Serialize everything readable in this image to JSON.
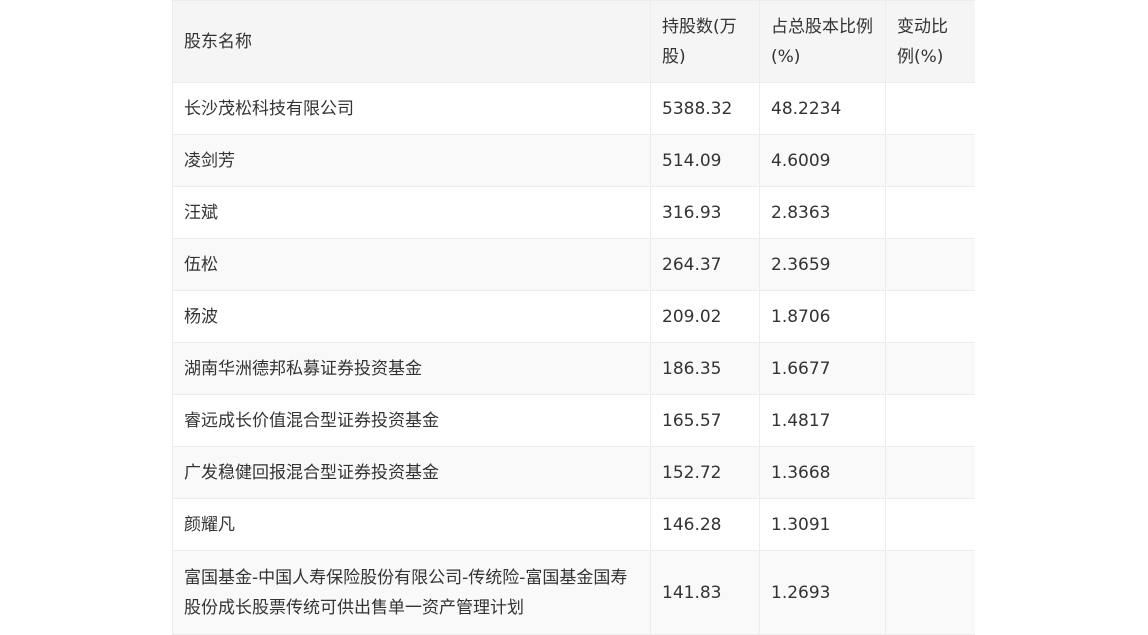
{
  "table": {
    "headers": [
      "股东名称",
      "持股数(万股)",
      "占总股本比例(%)",
      "变动比例(%)"
    ],
    "rows": [
      [
        "长沙茂松科技有限公司",
        "5388.32",
        "48.2234",
        ""
      ],
      [
        "凌剑芳",
        "514.09",
        "4.6009",
        ""
      ],
      [
        "汪斌",
        "316.93",
        "2.8363",
        ""
      ],
      [
        "伍松",
        "264.37",
        "2.3659",
        ""
      ],
      [
        "杨波",
        "209.02",
        "1.8706",
        ""
      ],
      [
        "湖南华洲德邦私募证券投资基金",
        "186.35",
        "1.6677",
        ""
      ],
      [
        "睿远成长价值混合型证券投资基金",
        "165.57",
        "1.4817",
        ""
      ],
      [
        "广发稳健回报混合型证券投资基金",
        "152.72",
        "1.3668",
        ""
      ],
      [
        "颜耀凡",
        "146.28",
        "1.3091",
        ""
      ],
      [
        "富国基金-中国人寿保险股份有限公司-传统险-富国基金国寿股份成长股票传统可供出售单一资产管理计划",
        "141.83",
        "1.2693",
        ""
      ]
    ]
  }
}
